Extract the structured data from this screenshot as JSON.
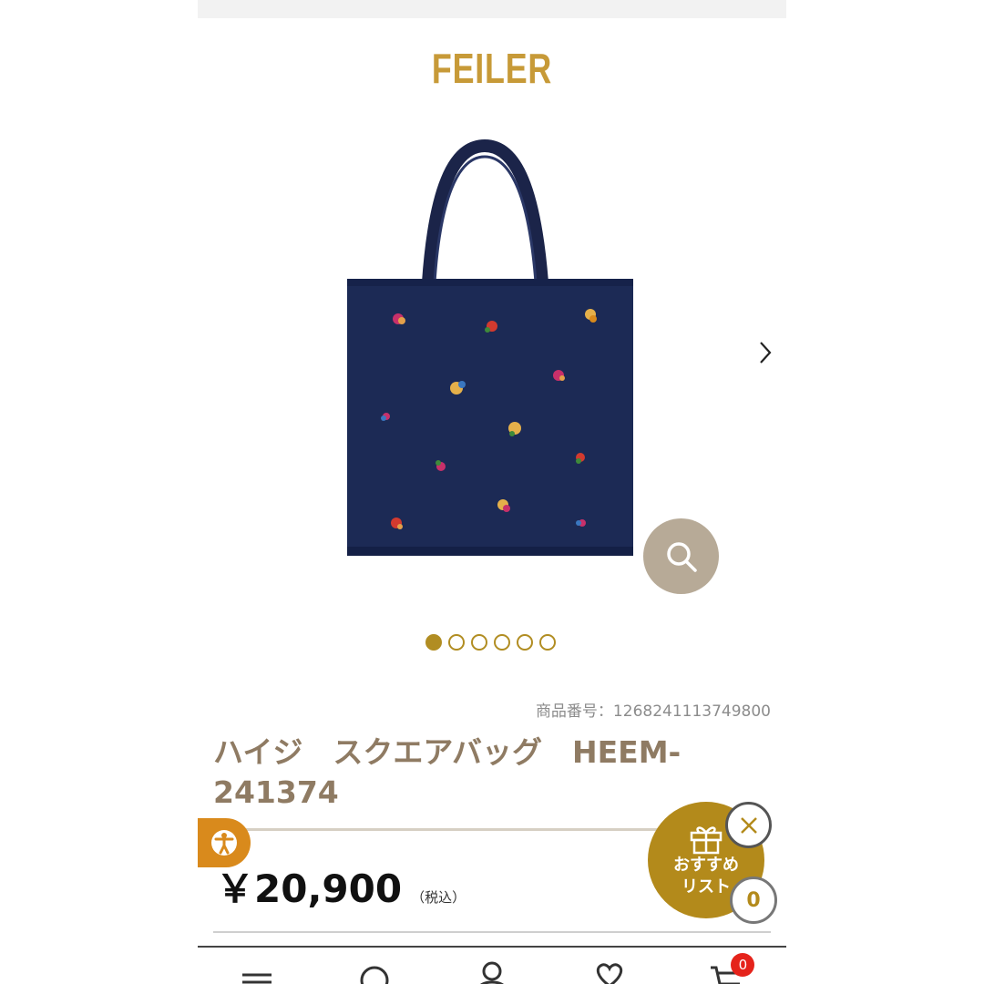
{
  "header": {
    "logo_text": "FEILER"
  },
  "gallery": {
    "image_alt": "navy square tote bag with embroidered motifs",
    "dots_total": 6,
    "active_index": 0,
    "next_icon": "chevron-right-icon",
    "zoom_icon": "search-icon"
  },
  "product": {
    "sku": "商品番号：1268241113749800",
    "title": "ハイジ　スクエアバッグ　HEEM-241374",
    "price": "￥20,900",
    "tax_note": "（税込）"
  },
  "recommend": {
    "label_line1": "おすすめ",
    "label_line2": "リスト",
    "count": "0",
    "icon": "gift-icon"
  },
  "nav": {
    "items": [
      "menu-icon",
      "search-icon",
      "account-icon",
      "favorite-icon",
      "cart-icon"
    ],
    "cart_count": "0"
  },
  "colors": {
    "brand_gold": "#c79a38",
    "accent_gold": "#b38a1b",
    "title_brown": "#8f7b63",
    "bag_navy": "#1c2a55",
    "badge_red": "#e5231b",
    "access_orange": "#d98a1c",
    "zoom_gray": "#b7aa97"
  }
}
